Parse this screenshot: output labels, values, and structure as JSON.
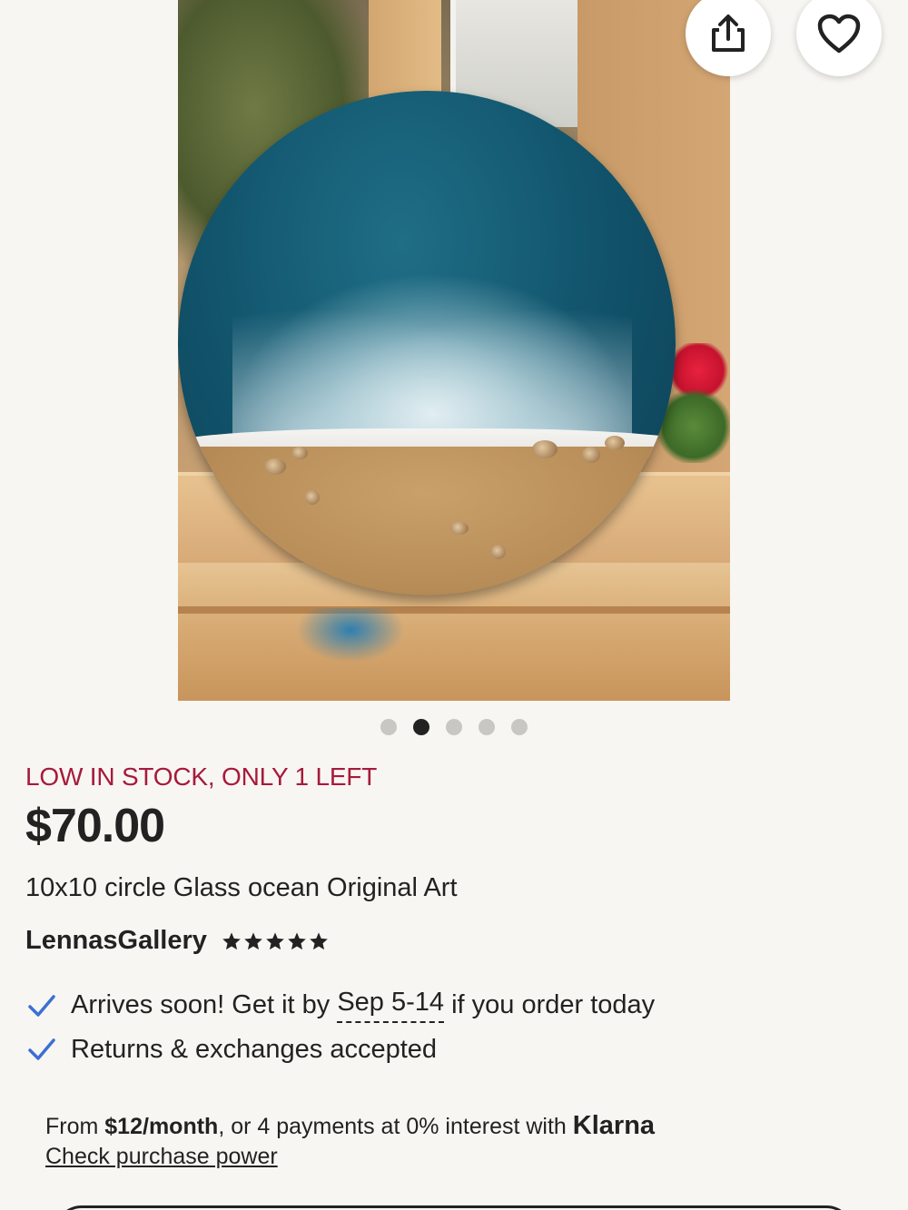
{
  "stock_notice": "LOW IN STOCK, ONLY 1 LEFT",
  "price": "$70.00",
  "title": "10x10 circle Glass ocean Original Art",
  "seller": {
    "name": "LennasGallery",
    "rating_stars": 5
  },
  "carousel": {
    "total": 5,
    "active_index": 1
  },
  "actions": {
    "share_icon": "share-icon",
    "favorite_icon": "heart-icon"
  },
  "features": {
    "delivery_prefix": "Arrives soon! Get it by ",
    "delivery_dates": "Sep 5-14",
    "delivery_suffix": " if you order today",
    "returns": "Returns & exchanges accepted"
  },
  "klarna": {
    "prefix": "From ",
    "monthly": "$12/month",
    "middle": ", or 4 payments at 0% interest with ",
    "brand": "Klarna",
    "link": "Check purchase power"
  },
  "colors": {
    "stock_red": "#a61a3b",
    "check_blue": "#3b6fd4",
    "background": "#f8f6f2"
  }
}
